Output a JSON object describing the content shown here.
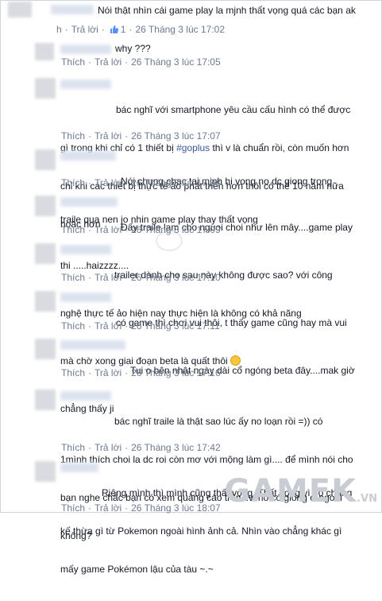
{
  "comments": [
    {
      "lines": [
        "Nói thật nhìn cái game play la mjnh thất vọng quá các bạn ak"
      ],
      "actions": {
        "like": "",
        "reply": "Trả lời",
        "likes": "1",
        "time": "26 Tháng 3 lúc 17:02"
      },
      "first_partial": "h"
    },
    {
      "lines": [
        "why ???"
      ],
      "actions": {
        "like": "Thích",
        "reply": "Trả lời",
        "time": "26 Tháng 3 lúc 17:05"
      }
    },
    {
      "lines": [
        "bác nghĩ với smartphone yêu cầu cấu hình có thể được",
        "gì trong khi chỉ có 1 thiết bị ",
        "chỉ khi các thiết bị thực tế ảo phát triển hơn thôi có thể 10 năm nữa",
        "hoặc hơn"
      ],
      "hashtag": "#goplus",
      "line2_rest": " thì v là chuẩn rồi, còn muốn hơn",
      "actions": {
        "like": "Thích",
        "reply": "Trả lời",
        "time": "26 Tháng 3 lúc 17:07"
      }
    },
    {
      "lines": [
        "Nói chung chac tai mjnh hi vong no dc giong trong",
        "traile qua nen jo nhin game play thay thất vọng"
      ],
      "actions": {
        "like": "Thích",
        "reply": "Trả lời",
        "time": "26 Tháng 3 lúc 17:08"
      }
    },
    {
      "lines": [
        "Đấy traile lam cho nguoi choi như lên mây....game play",
        "thi .....haizzzz...."
      ],
      "actions": {
        "like": "Thích",
        "reply": "Trả lời",
        "time": "26 Tháng 3 lúc 17:09"
      }
    },
    {
      "lines": [
        "trailer dành cho sau này không được sao? với công",
        "nghệ thực tế ảo hiện nay thực hiện là không có khả năng"
      ],
      "actions": {
        "like": "Thích",
        "reply": "Trả lời",
        "time": "26 Tháng 3 lúc 17:10"
      }
    },
    {
      "lines": [
        "có game thì chơi vui thôi, t thấy game cũng hay mà vui",
        "mà chờ xong giai đoạn beta là quất thôi "
      ],
      "actions": {
        "like": "Thích",
        "reply": "Trả lời",
        "time": "26 Tháng 3 lúc 17:11"
      }
    },
    {
      "lines": [
        "Tui o bên nhật ngày dài cổ ngóng beta đây....mak giờ",
        "chẳng thấy ji"
      ],
      "actions": {
        "like": "Thích",
        "reply": "Trả lời",
        "time": "26 Tháng 3 lúc 17:16"
      }
    },
    {
      "lines": [
        "bác nghĩ traile là thật sao lúc ấy no loạn rồi =)) có",
        "1mình thích choi la dc roi còn mơ với mộng làm gì.... để mình nói cho",
        "bạn nghe chắc bạn có xem quảng cáo trên tivi nó có giống ở ngoài",
        "không?"
      ],
      "actions": {
        "like": "Thích",
        "reply": "Trả lời",
        "time": "26 Tháng 3 lúc 17:42"
      }
    },
    {
      "lines": [
        "Riêng mình thì mình cũng thất vọng. Thất vọng vì nó chẳng",
        "kế thừa gì từ Pokemon ngoài hình ảnh cả. Nhìn vào chẳng khác gì",
        "mấy game Pokémon lậu của tàu ~.~"
      ],
      "actions": {
        "like": "Thích",
        "reply": "Trả lời",
        "time": "26 Tháng 3 lúc 18:07"
      }
    }
  ],
  "watermark": {
    "main": "GAMEK",
    "suffix": ".VN"
  }
}
